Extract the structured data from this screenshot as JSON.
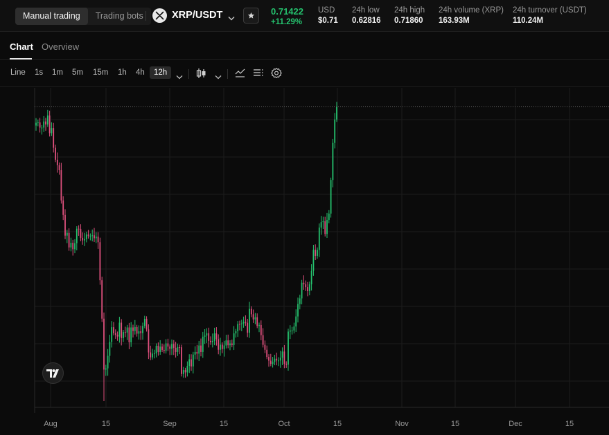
{
  "header": {
    "mode_tabs": [
      {
        "label": "Manual trading",
        "active": true
      },
      {
        "label": "Trading bots",
        "active": false
      }
    ],
    "pair": "XRP/USDT",
    "logo_icon": "xrp-logo-icon",
    "favorite_icon": "star-icon",
    "last_price": "0.71422",
    "change_pct": "+11.29%",
    "stats": [
      {
        "label": "USD",
        "value": "$0.71"
      },
      {
        "label": "24h low",
        "value": "0.62816"
      },
      {
        "label": "24h high",
        "value": "0.71860"
      },
      {
        "label": "24h volume (XRP)",
        "value": "163.93M"
      },
      {
        "label": "24h turnover (USDT)",
        "value": "110.24M"
      }
    ]
  },
  "tabs": [
    {
      "label": "Chart",
      "active": true
    },
    {
      "label": "Overview",
      "active": false
    }
  ],
  "toolbar": {
    "chart_type_label": "Line",
    "timeframes": [
      "1s",
      "1m",
      "5m",
      "15m",
      "1h",
      "4h",
      "12h"
    ],
    "active_timeframe": "12h",
    "icons": [
      "chevron-down-icon",
      "candlestick-icon",
      "chevron-down-icon",
      "indicators-icon",
      "list-icon",
      "settings-icon"
    ]
  },
  "colors": {
    "up": "#25c26e",
    "down": "#e0507e",
    "background": "#0b0b0b",
    "grid": "#1d1d1d"
  },
  "chart_data": {
    "type": "candlestick",
    "interval": "12h",
    "x_tick_labels": [
      "Aug",
      "15",
      "Sep",
      "15",
      "Oct",
      "15",
      "Nov",
      "15",
      "Dec",
      "15"
    ],
    "current_price": 0.71422,
    "price_line": "dotted",
    "y_axis_visible": false,
    "grid": true,
    "series": [
      {
        "name": "XRP/USDT",
        "values": [
          0.7026,
          0.7029,
          0.6991,
          0.6991,
          0.7036,
          0.7014,
          0.7079,
          0.6951,
          0.6988,
          0.6845,
          0.6758,
          0.6718,
          0.6682,
          0.6462,
          0.6357,
          0.6207,
          0.6227,
          0.6121,
          0.6155,
          0.6108,
          0.6152,
          0.6257,
          0.6256,
          0.6191,
          0.6172,
          0.6182,
          0.6215,
          0.6204,
          0.6206,
          0.6209,
          0.6188,
          0.6199,
          0.6159,
          0.5883,
          0.5604,
          0.5234,
          0.5243,
          0.5334,
          0.5435,
          0.5542,
          0.5498,
          0.5487,
          0.5474,
          0.5575,
          0.5463,
          0.5507,
          0.5503,
          0.554,
          0.5432,
          0.554,
          0.5514,
          0.5543,
          0.5495,
          0.5512,
          0.5499,
          0.5551,
          0.5603,
          0.5526,
          0.5359,
          0.5323,
          0.535,
          0.5352,
          0.5407,
          0.5362,
          0.5401,
          0.5377,
          0.537,
          0.5424,
          0.5401,
          0.5385,
          0.542,
          0.5392,
          0.5362,
          0.5397,
          0.5396,
          0.5202,
          0.5231,
          0.5214,
          0.5261,
          0.5309,
          0.5257,
          0.5343,
          0.5362,
          0.535,
          0.5409,
          0.5362,
          0.5473,
          0.5481,
          0.5498,
          0.5443,
          0.5432,
          0.5442,
          0.5497,
          0.5455,
          0.5378,
          0.5415,
          0.5383,
          0.5409,
          0.5446,
          0.5411,
          0.5424,
          0.5412,
          0.5497,
          0.5513,
          0.5565,
          0.5564,
          0.5569,
          0.558,
          0.5574,
          0.5502,
          0.5675,
          0.5636,
          0.5598,
          0.5614,
          0.5551,
          0.5558,
          0.5484,
          0.5414,
          0.5378,
          0.5326,
          0.5299,
          0.5275,
          0.529,
          0.5313,
          0.53,
          0.53,
          0.532,
          0.5365,
          0.5276,
          0.527,
          0.551,
          0.5518,
          0.5518,
          0.5547,
          0.562,
          0.571,
          0.5751,
          0.5865,
          0.5853,
          0.5833,
          0.5804,
          0.5853,
          0.5951,
          0.6104,
          0.606,
          0.6103,
          0.6265,
          0.6305,
          0.6311,
          0.6219,
          0.6321,
          0.6367,
          0.6611,
          0.688,
          0.705,
          0.7142
        ]
      }
    ]
  }
}
